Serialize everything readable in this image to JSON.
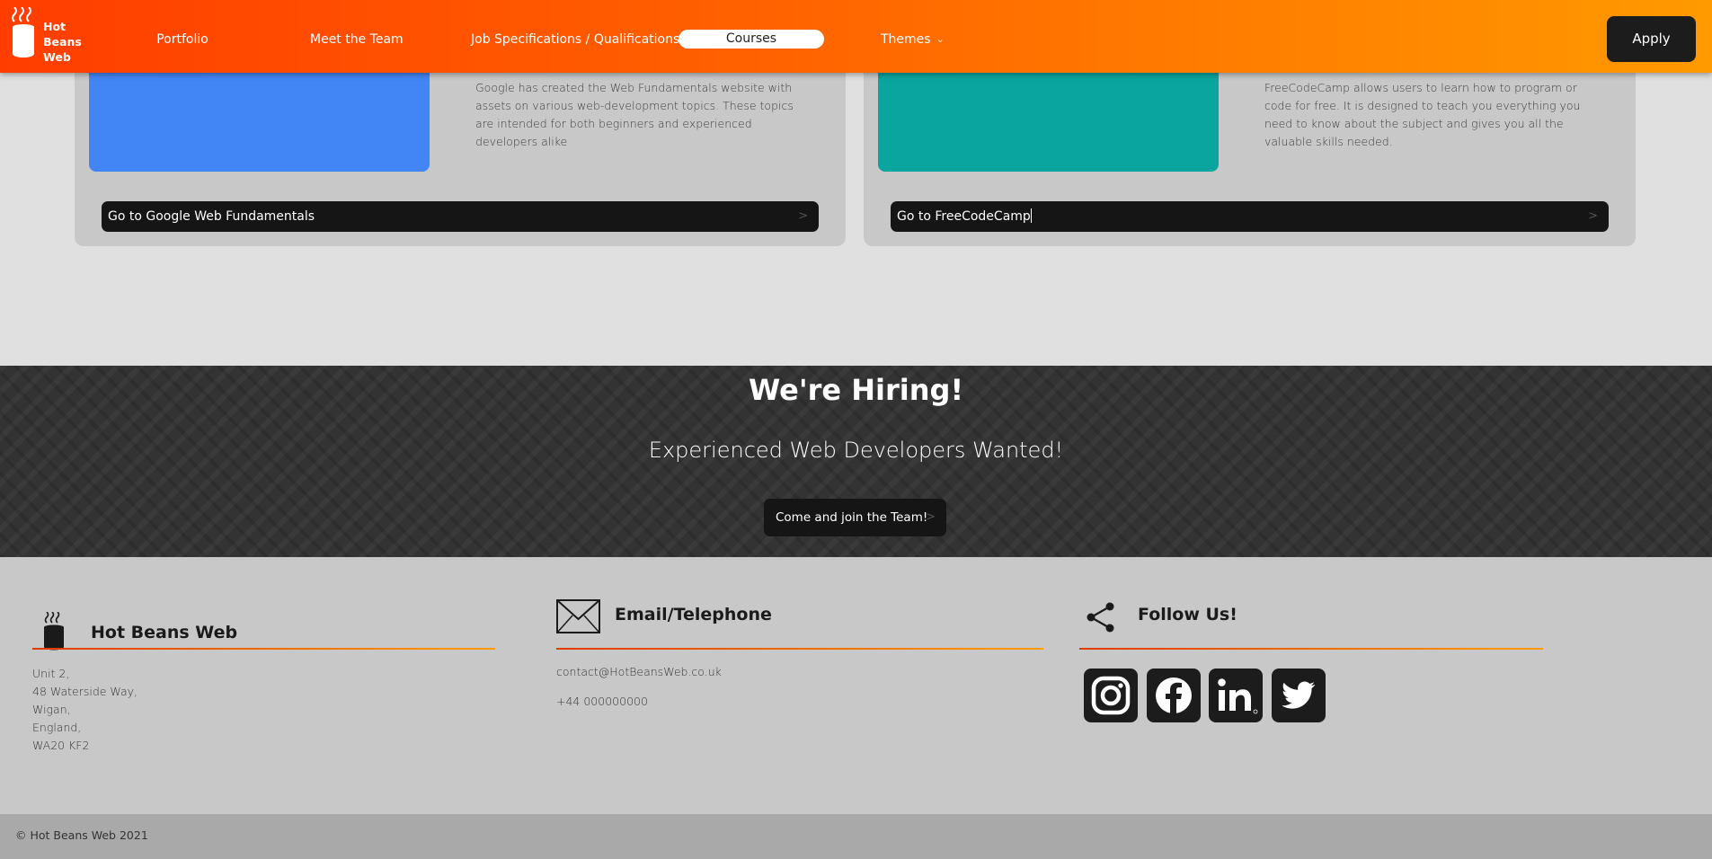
{
  "brand": {
    "name_lines": [
      "Hot",
      "Beans",
      "Web"
    ]
  },
  "nav": {
    "items": [
      {
        "label": "Portfolio"
      },
      {
        "label": "Meet the Team"
      },
      {
        "label": "Job Specifications / Qualifications"
      },
      {
        "label": "Courses",
        "active": true
      },
      {
        "label": "Themes",
        "has_dropdown": true
      }
    ],
    "apply_label": "Apply"
  },
  "courses": [
    {
      "description": "Google has created the Web Fundamentals website with assets on various web-development topics. These topics are intended for both beginners and experienced developers alike",
      "link_label": "Go to Google Web Fundamentals",
      "image_color": "#4285f4"
    },
    {
      "description": "FreeCodeCamp allows users to learn how to program or code for free. It is designed to teach you everything you need to know about the subject and gives you all the valuable skills needed.",
      "link_label": "Go to FreeCodeCamp",
      "image_color": "#0aa59f"
    }
  ],
  "hiring": {
    "title": "We're Hiring!",
    "subtitle": "Experienced Web Developers Wanted!",
    "button_label": "Come and join the Team!"
  },
  "footer": {
    "company": {
      "title": "Hot Beans Web",
      "address": [
        "Unit 2,",
        "48 Waterside Way,",
        "Wigan,",
        "England,",
        "WA20 KF2"
      ]
    },
    "contact": {
      "title": "Email/Telephone",
      "email": "contact@HotBeansWeb.co.uk",
      "phone": "+44 000000000"
    },
    "social": {
      "title": "Follow Us!",
      "networks": [
        "instagram-icon",
        "facebook-icon",
        "linkedin-icon",
        "twitter-icon"
      ]
    },
    "copyright": "© Hot Beans Web 2021"
  },
  "colors": {
    "nav_gradient_start": "#ff3d00",
    "nav_gradient_end": "#ff9a00",
    "dark_button": "#151515"
  }
}
